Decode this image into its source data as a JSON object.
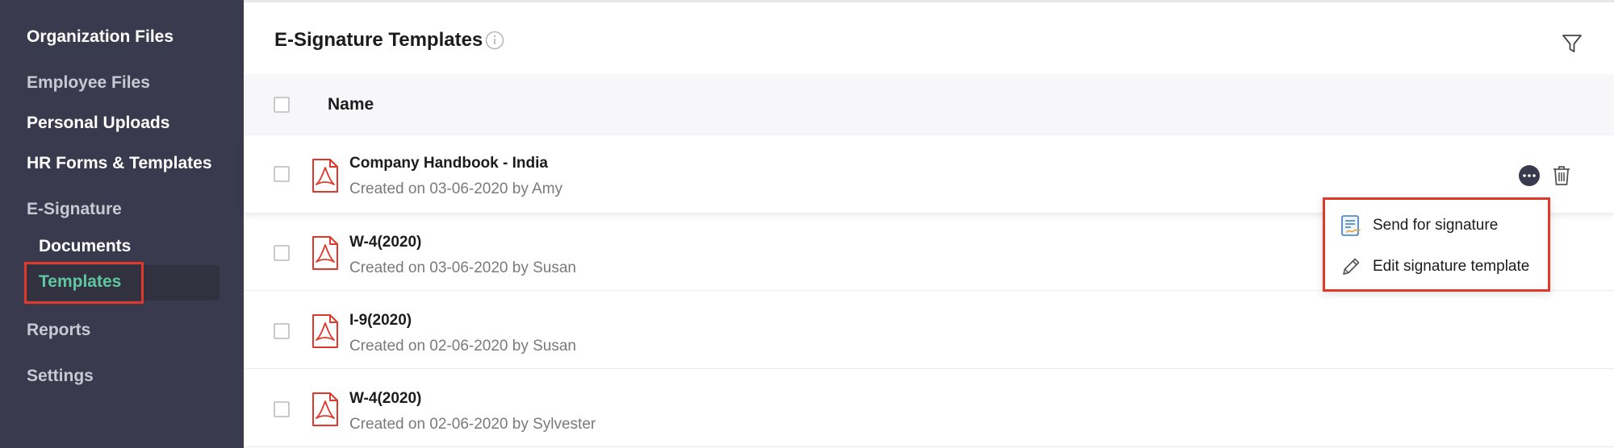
{
  "sidebar": {
    "items": [
      {
        "label": "Organization Files"
      },
      {
        "label": "Employee Files"
      },
      {
        "label": "Personal Uploads"
      },
      {
        "label": "HR Forms & Templates"
      },
      {
        "label": "E-Signature"
      },
      {
        "label": "Reports"
      },
      {
        "label": "Settings"
      }
    ],
    "esignature_children": [
      {
        "label": "Documents"
      },
      {
        "label": "Templates",
        "active": true
      }
    ],
    "colors": {
      "background": "#3a3a4e",
      "active_text": "#5ec8a0",
      "highlight": "#e0392b"
    }
  },
  "header": {
    "title": "E-Signature Templates",
    "info_icon": "info-icon",
    "filter_icon": "filter-icon"
  },
  "table": {
    "column_name": "Name",
    "rows": [
      {
        "title": "Company Handbook - India",
        "subtitle": "Created on 03-06-2020 by Amy"
      },
      {
        "title": "W-4(2020)",
        "subtitle": "Created on 03-06-2020 by Susan"
      },
      {
        "title": "I-9(2020)",
        "subtitle": "Created on 02-06-2020 by Susan"
      },
      {
        "title": "W-4(2020)",
        "subtitle": "Created on 02-06-2020 by Sylvester"
      }
    ],
    "row_icon": "pdf-icon"
  },
  "row_actions": {
    "more_icon": "more-icon",
    "delete_icon": "trash-icon"
  },
  "context_menu": {
    "items": [
      {
        "label": "Send for signature",
        "icon": "send-signature-icon"
      },
      {
        "label": "Edit signature template",
        "icon": "pencil-icon"
      }
    ]
  }
}
